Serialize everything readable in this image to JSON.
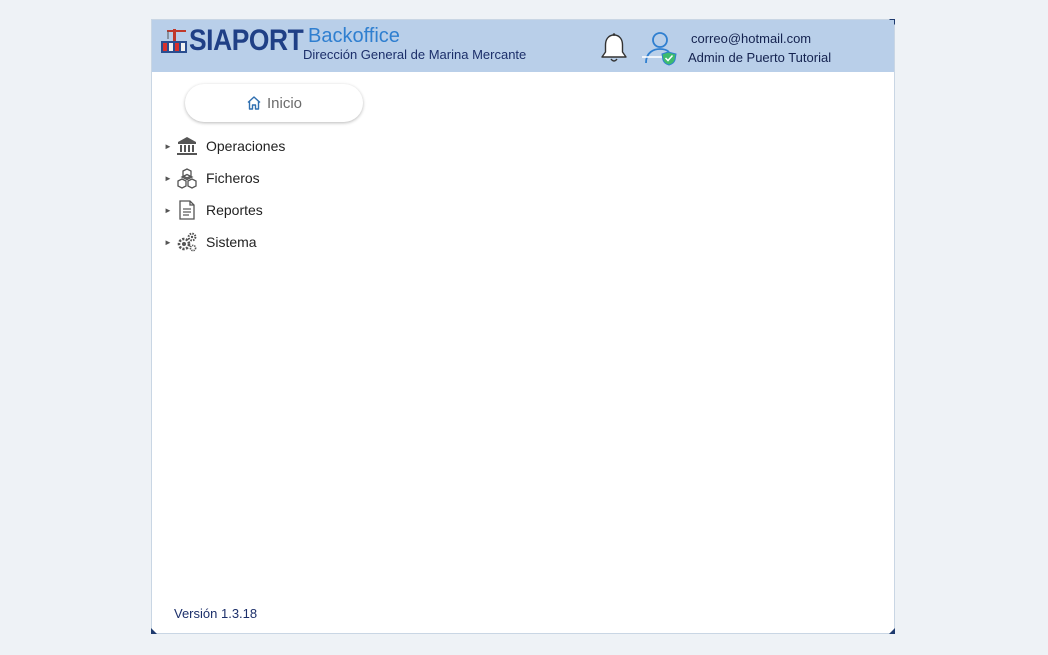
{
  "header": {
    "logo_text": "SIAPORT",
    "app_title": "Backoffice",
    "app_subtitle": "Dirección General de Marina Mercante",
    "notification_icon": "bell-icon",
    "user_icon": "user-shield-icon",
    "user_email": "correo@hotmail.com",
    "user_role": "Admin de Puerto Tutorial"
  },
  "nav": {
    "home_label": "Inicio",
    "home_icon": "home-icon",
    "items": [
      {
        "label": "Operaciones",
        "icon": "bank-icon"
      },
      {
        "label": "Ficheros",
        "icon": "boxes-icon"
      },
      {
        "label": "Reportes",
        "icon": "document-icon"
      },
      {
        "label": "Sistema",
        "icon": "gears-icon"
      }
    ]
  },
  "footer": {
    "version": "Versión 1.3.18"
  },
  "colors": {
    "header_bg": "#b9cfe9",
    "brand_dark": "#1f3f86",
    "brand_light": "#2f7fd0",
    "page_bg": "#eef2f6"
  }
}
